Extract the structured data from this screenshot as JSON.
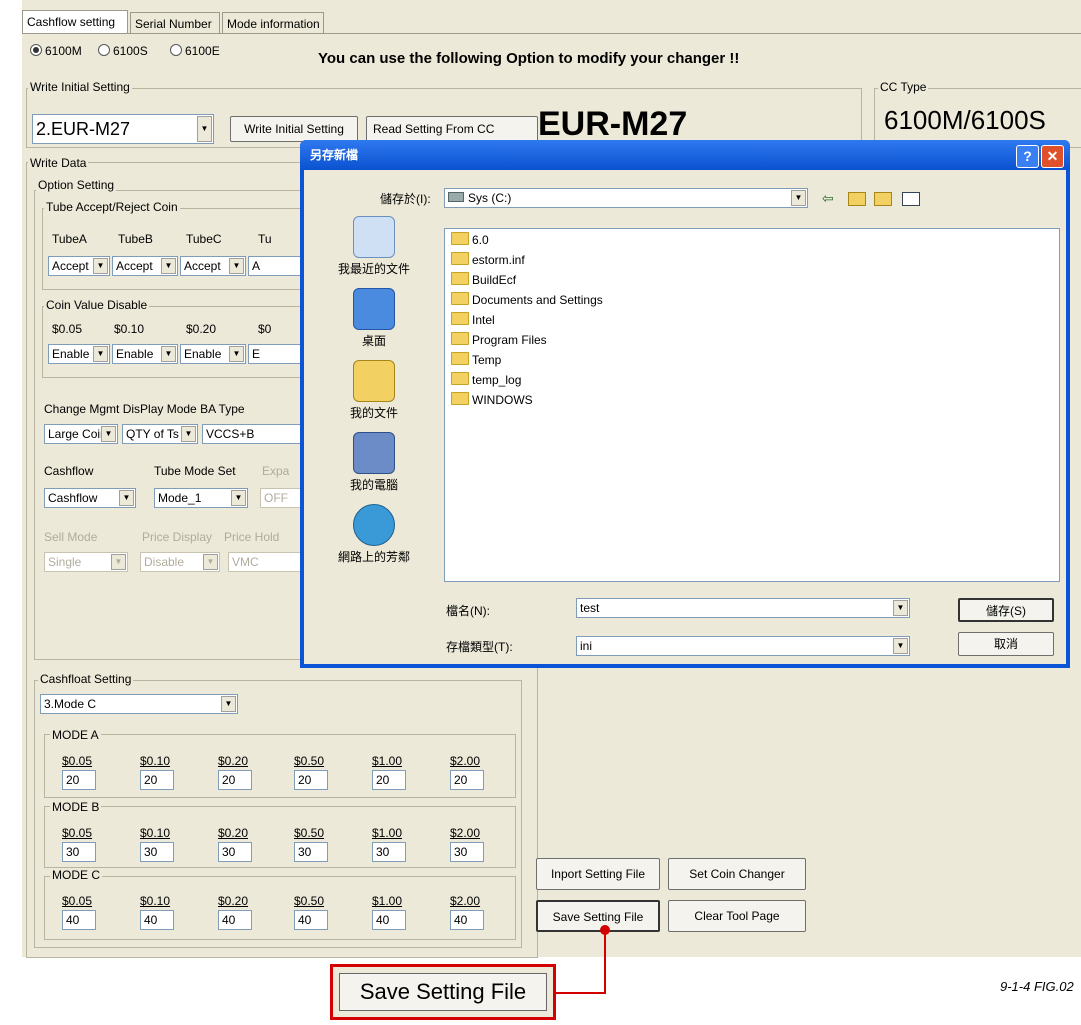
{
  "tabs": [
    "Cashflow setting",
    "Serial Number",
    "Mode information"
  ],
  "model_radios": [
    {
      "label": "6100M",
      "selected": true
    },
    {
      "label": "6100S",
      "selected": false
    },
    {
      "label": "6100E",
      "selected": false
    }
  ],
  "headline": "You can use the following Option to modify your changer !!",
  "initial": {
    "group_title": "Write Initial Setting",
    "combo_value": "2.EUR-M27",
    "write_btn": "Write Initial Setting",
    "read_btn": "Read Setting From CC",
    "big_label": "EUR-M27"
  },
  "cc_type": {
    "title": "CC Type",
    "value": "6100M/6100S"
  },
  "write_data": {
    "title": "Write Data",
    "option_title": "Option Setting",
    "tube_title": "Tube Accept/Reject Coin",
    "tube_headers": [
      "TubeA",
      "TubeB",
      "TubeC",
      "Tu"
    ],
    "tube_values": [
      "Accept",
      "Accept",
      "Accept",
      "A"
    ],
    "coin_title": "Coin Value Disable",
    "coin_headers": [
      "$0.05",
      "$0.10",
      "$0.20",
      "$0"
    ],
    "coin_values": [
      "Enable",
      "Enable",
      "Enable",
      "E"
    ],
    "mgmt_label": "Change Mgmt  DisPlay Mode  BA Type",
    "mgmt_values": [
      "Large Coir",
      "QTY of Ts",
      "VCCS+B"
    ],
    "cashflow_label": "Cashflow",
    "tubemode_label": "Tube Mode Set",
    "tubemode_extra": "Expa",
    "cashflow_values": [
      "Cashflow",
      "Mode_1",
      "OFF"
    ],
    "sell_labels": [
      "Sell Mode",
      "Price Display",
      "Price Hold"
    ],
    "sell_values": [
      "Single",
      "Disable",
      "VMC"
    ]
  },
  "cashfloat": {
    "title": "Cashfloat Setting",
    "combo_value": "3.Mode C",
    "modes": [
      {
        "name": "MODE A",
        "headers": [
          "$0.05",
          "$0.10",
          "$0.20",
          "$0.50",
          "$1.00",
          "$2.00"
        ],
        "values": [
          "20",
          "20",
          "20",
          "20",
          "20",
          "20"
        ]
      },
      {
        "name": "MODE B",
        "headers": [
          "$0.05",
          "$0.10",
          "$0.20",
          "$0.50",
          "$1.00",
          "$2.00"
        ],
        "values": [
          "30",
          "30",
          "30",
          "30",
          "30",
          "30"
        ]
      },
      {
        "name": "MODE C",
        "headers": [
          "$0.05",
          "$0.10",
          "$0.20",
          "$0.50",
          "$1.00",
          "$2.00"
        ],
        "values": [
          "40",
          "40",
          "40",
          "40",
          "40",
          "40"
        ]
      }
    ]
  },
  "buttons": {
    "import": "Inport Setting File",
    "set_changer": "Set  Coin Changer",
    "save": "Save Setting File",
    "clear": "Clear Tool Page"
  },
  "dialog": {
    "title": "另存新檔",
    "save_in_label": "儲存於(I):",
    "save_in_value": "Sys (C:)",
    "places": [
      "我最近的文件",
      "桌面",
      "我的文件",
      "我的電腦",
      "網路上的芳鄰"
    ],
    "files": [
      "6.0",
      "estorm.inf",
      "BuildEcf",
      "Documents and Settings",
      "Intel",
      "Program Files",
      "Temp",
      "temp_log",
      "WINDOWS"
    ],
    "filename_label": "檔名(N):",
    "filename_value": "test",
    "filetype_label": "存檔類型(T):",
    "filetype_value": "ini",
    "save_btn": "儲存(S)",
    "cancel_btn": "取消"
  },
  "callout_label": "Save Setting File",
  "figure_label": "9-1-4 FIG.02"
}
